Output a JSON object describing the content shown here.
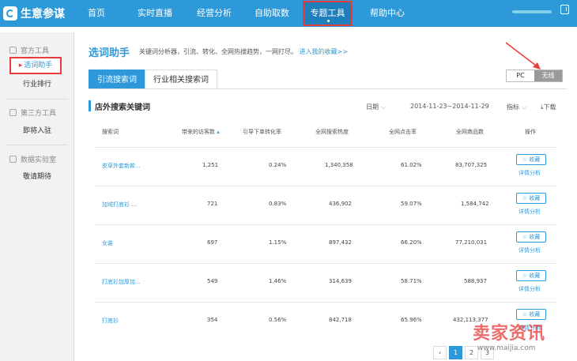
{
  "app": {
    "logo_text": "生意参谋",
    "nav": [
      "首页",
      "实时直播",
      "经营分析",
      "自助取数",
      "专题工具",
      "帮助中心"
    ]
  },
  "sidebar": {
    "groups": [
      {
        "label": "官方工具",
        "items": [
          "选词助手",
          "行业排行"
        ]
      },
      {
        "label": "第三方工具",
        "items": [
          "即将入驻"
        ]
      },
      {
        "label": "数据实验室",
        "items": [
          "敬请期待"
        ]
      }
    ]
  },
  "main": {
    "title": "选词助手",
    "desc": "关键词分析器，引流、转化、全网热搜趋势，一网打尽。",
    "desc_link": "进入我的收藏>>",
    "tabs": [
      "引流搜索词",
      "行业相关搜索词"
    ],
    "device_toggle": {
      "pc": "PC",
      "wireless": "无线",
      "active": "无线"
    },
    "section_title": "店外搜索关键词",
    "date_label": "日期",
    "date_range": "2014-11-23~2014-11-29",
    "metric_label": "指标",
    "download_label": "下载"
  },
  "table": {
    "headers": [
      "搜索词",
      "带来的访客数",
      "引导下单转化率",
      "全网搜索热度",
      "全网点击率",
      "全网商品数",
      "操作"
    ],
    "rows": [
      [
        "皮草外套新款...",
        "1,251",
        "0.24%",
        "1,340,358",
        "61.02%",
        "83,707,325"
      ],
      [
        "加绒打底衫 ...",
        "721",
        "0.83%",
        "436,902",
        "59.07%",
        "1,584,742"
      ],
      [
        "女装",
        "697",
        "1.15%",
        "897,432",
        "66.20%",
        "77,210,031"
      ],
      [
        "打底衫加厚加...",
        "549",
        "1.46%",
        "314,639",
        "58.71%",
        "588,937"
      ],
      [
        "打底衫",
        "354",
        "0.56%",
        "842,718",
        "65.96%",
        "432,113,377"
      ]
    ],
    "fav_label": "收藏",
    "detail_label": "详情分析"
  },
  "pagination": {
    "pages": [
      "1",
      "2",
      "3"
    ],
    "current": "1",
    "prev": "‹"
  },
  "watermark": {
    "main": "卖家资讯",
    "sub": "www.maijia.com"
  },
  "colors": {
    "accent": "#2e99d8",
    "highlight": "#e83c3c"
  }
}
